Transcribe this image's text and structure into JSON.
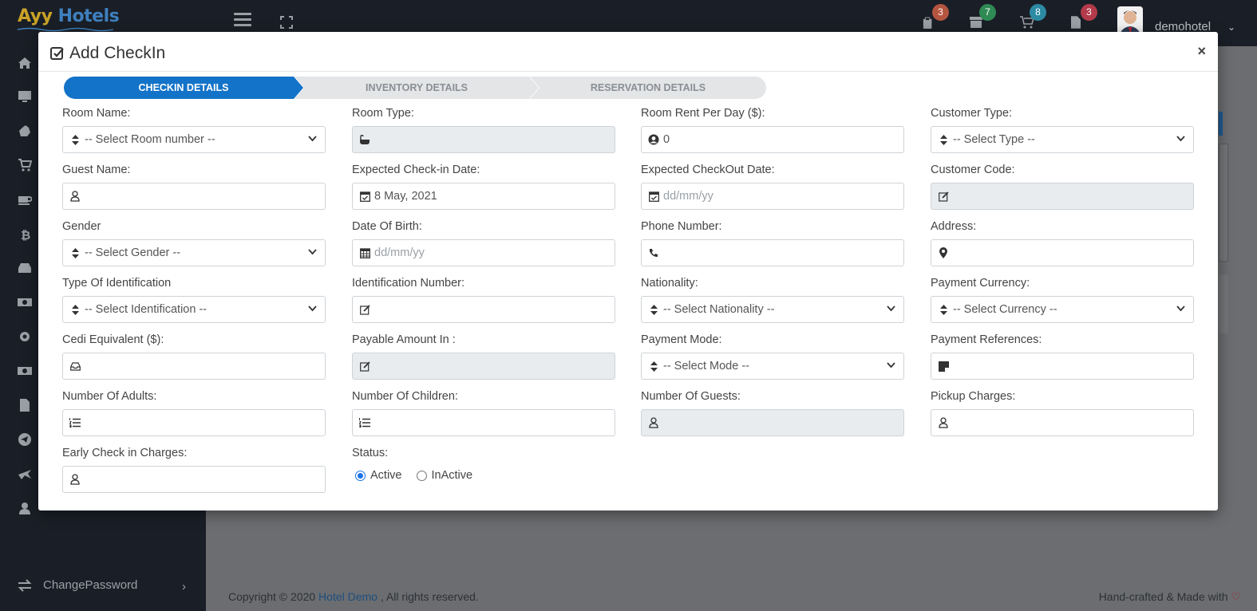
{
  "app": {
    "logo_a": "Ayy",
    "logo_h": "Hotels",
    "user_name": "demohotel",
    "badges": [
      "3",
      "7",
      "8",
      "3"
    ],
    "badge_colors": [
      "#b4553f",
      "#2f8a54",
      "#2c8aa3",
      "#b33a4a"
    ],
    "sidebar_link": "ChangePassword"
  },
  "footer": {
    "copyright_prefix": "Copyright © 2020 ",
    "company": "Hotel Demo",
    "copyright_suffix": " , All rights reserved.",
    "made_with": "Hand-crafted & Made with "
  },
  "modal": {
    "title": "Add CheckIn",
    "steps": [
      "CHECKIN DETAILS",
      "INVENTORY DETAILS",
      "RESERVATION DETAILS"
    ],
    "active_step": 0,
    "fields": {
      "room_name": {
        "label": "Room Name:",
        "value": "-- Select Room number --"
      },
      "room_type": {
        "label": "Room Type:"
      },
      "room_rent": {
        "label": "Room Rent Per Day ($):",
        "value": "0"
      },
      "customer_type": {
        "label": "Customer Type:",
        "value": "-- Select Type --"
      },
      "guest_name": {
        "label": "Guest Name:"
      },
      "checkin_date": {
        "label": "Expected Check-in Date:",
        "value": "8 May, 2021"
      },
      "checkout_date": {
        "label": "Expected CheckOut Date:",
        "placeholder": "dd/mm/yy"
      },
      "customer_code": {
        "label": "Customer Code:"
      },
      "gender": {
        "label": "Gender",
        "value": "-- Select Gender --"
      },
      "dob": {
        "label": "Date Of Birth:",
        "placeholder": "dd/mm/yy"
      },
      "phone": {
        "label": "Phone Number:"
      },
      "address": {
        "label": "Address:"
      },
      "id_type": {
        "label": "Type Of Identification",
        "value": "-- Select Identification --"
      },
      "id_number": {
        "label": "Identification Number:"
      },
      "nationality": {
        "label": "Nationality:",
        "value": "-- Select Nationality --"
      },
      "payment_currency": {
        "label": "Payment Currency:",
        "value": "-- Select Currency --"
      },
      "cedi_equivalent": {
        "label": "Cedi Equivalent ($):"
      },
      "payable_amount": {
        "label": "Payable Amount In :"
      },
      "payment_mode": {
        "label": "Payment Mode:",
        "value": "-- Select Mode --"
      },
      "payment_refs": {
        "label": "Payment References:"
      },
      "adults": {
        "label": "Number Of Adults:"
      },
      "children": {
        "label": "Number Of Children:"
      },
      "guests": {
        "label": "Number Of Guests:"
      },
      "pickup": {
        "label": "Pickup Charges:"
      },
      "early_checkin": {
        "label": "Early Check in Charges:"
      },
      "status": {
        "label": "Status:",
        "options": [
          "Active",
          "InActive"
        ],
        "selected": "Active"
      }
    }
  }
}
